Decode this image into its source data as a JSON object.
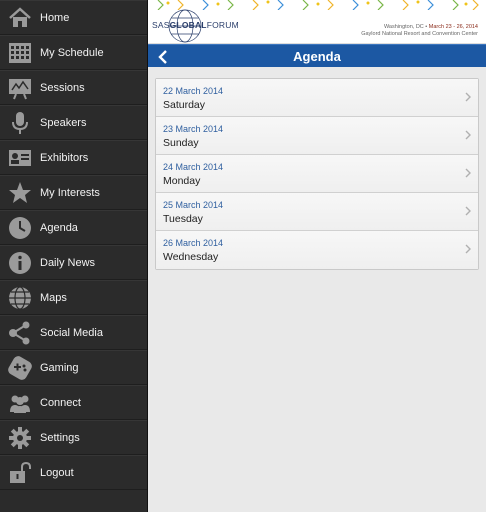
{
  "sidebar": {
    "items": [
      {
        "label": "Home",
        "icon": "home-icon"
      },
      {
        "label": "My Schedule",
        "icon": "calendar-icon"
      },
      {
        "label": "Sessions",
        "icon": "presentation-icon"
      },
      {
        "label": "Speakers",
        "icon": "microphone-icon"
      },
      {
        "label": "Exhibitors",
        "icon": "id-card-icon"
      },
      {
        "label": "My Interests",
        "icon": "star-icon"
      },
      {
        "label": "Agenda",
        "icon": "clock-icon"
      },
      {
        "label": "Daily News",
        "icon": "info-icon"
      },
      {
        "label": "Maps",
        "icon": "globe-icon"
      },
      {
        "label": "Social Media",
        "icon": "share-icon"
      },
      {
        "label": "Gaming",
        "icon": "gamepad-icon"
      },
      {
        "label": "Connect",
        "icon": "people-icon"
      },
      {
        "label": "Settings",
        "icon": "gear-icon"
      },
      {
        "label": "Logout",
        "icon": "unlock-icon"
      }
    ]
  },
  "banner": {
    "logo_prefix": "SAS",
    "logo_main": "GLOBAL",
    "logo_suffix": "FORUM",
    "location": "Washington, DC",
    "dates": "March 23 - 26, 2014",
    "venue": "Gaylord National Resort and Convention Center"
  },
  "header": {
    "title": "Agenda"
  },
  "agenda": {
    "days": [
      {
        "date": "22 March 2014",
        "weekday": "Saturday"
      },
      {
        "date": "23 March 2014",
        "weekday": "Sunday"
      },
      {
        "date": "24 March 2014",
        "weekday": "Monday"
      },
      {
        "date": "25 March 2014",
        "weekday": "Tuesday"
      },
      {
        "date": "26 March 2014",
        "weekday": "Wednesday"
      }
    ]
  },
  "colors": {
    "sidebar_bg": "#2b2b2b",
    "header_bg": "#1c58a3",
    "date_text": "#2f5f9f"
  }
}
